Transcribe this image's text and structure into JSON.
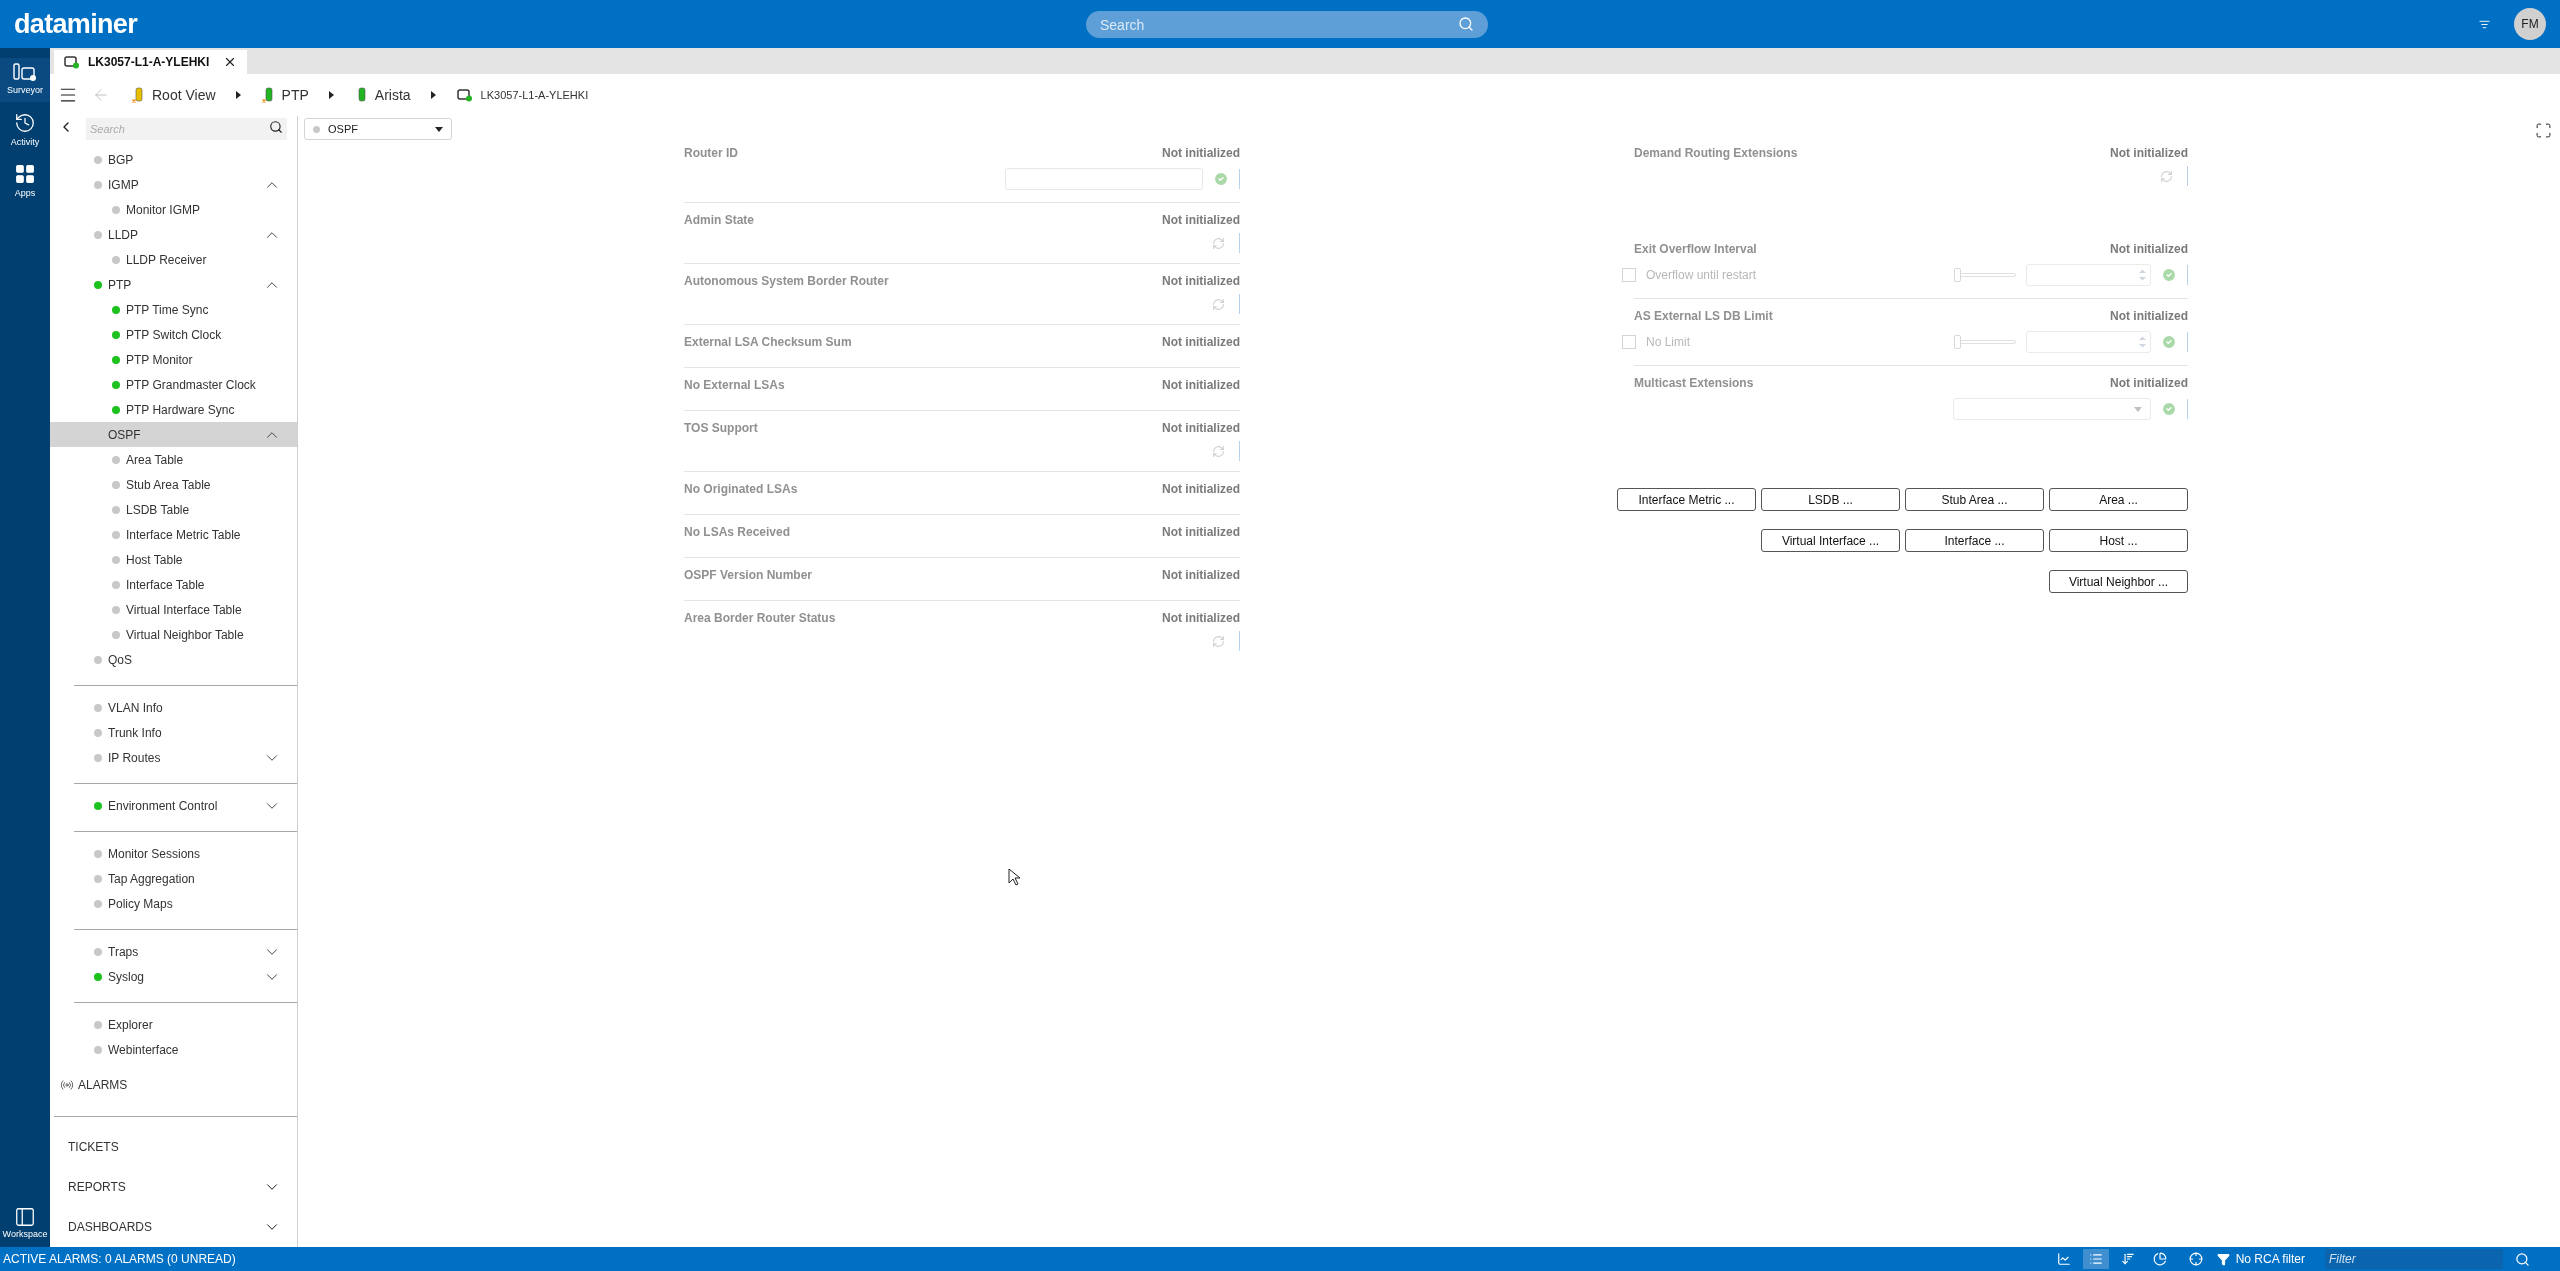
{
  "header": {
    "logo": "dataminer",
    "search": {
      "placeholder": "Search"
    },
    "avatar": "FM"
  },
  "rail": {
    "items": [
      {
        "kind": "surveyor",
        "label": "Surveyor",
        "selected": true
      },
      {
        "kind": "activity",
        "label": "Activity",
        "selected": false
      },
      {
        "kind": "apps",
        "label": "Apps",
        "selected": false
      }
    ],
    "workspace": "Workspace"
  },
  "tab": {
    "label": "LK3057-L1-A-YLEHKI"
  },
  "breadcrumb": [
    {
      "kind": "view-warning",
      "color": "#e8c000",
      "label": "Root View"
    },
    {
      "kind": "view-warning",
      "color": "#22b422",
      "label": "PTP"
    },
    {
      "kind": "view",
      "color": "#22b422",
      "label": "Arista"
    },
    {
      "kind": "element",
      "color": "#22b422",
      "label": "LK3057-L1-A-YLEHKI"
    }
  ],
  "sidebar": {
    "search": {
      "placeholder": "Search"
    },
    "sections": [
      [
        {
          "label": "BGP",
          "color": "#c8c8c8",
          "selected": false
        },
        {
          "label": "IGMP",
          "color": "#c8c8c8",
          "selected": false,
          "expanded": true,
          "children": [
            {
              "label": "Monitor IGMP",
              "color": "#c8c8c8",
              "selected": false
            }
          ]
        },
        {
          "label": "LLDP",
          "color": "#c8c8c8",
          "selected": false,
          "expanded": true,
          "children": [
            {
              "label": "LLDP Receiver",
              "color": "#c8c8c8",
              "selected": false
            }
          ]
        },
        {
          "label": "PTP",
          "color": "#1ec21e",
          "selected": false,
          "expanded": true,
          "children": [
            {
              "label": "PTP Time Sync",
              "color": "#1ec21e",
              "selected": false
            },
            {
              "label": "PTP Switch Clock",
              "color": "#1ec21e",
              "selected": false
            },
            {
              "label": "PTP Monitor",
              "color": "#1ec21e",
              "selected": false
            },
            {
              "label": "PTP Grandmaster Clock",
              "color": "#1ec21e",
              "selected": false
            },
            {
              "label": "PTP Hardware Sync",
              "color": "#1ec21e",
              "selected": false
            }
          ]
        },
        {
          "label": "OSPF",
          "selected": true,
          "expanded": true,
          "children": [
            {
              "label": "Area Table",
              "color": "#c8c8c8",
              "selected": false
            },
            {
              "label": "Stub Area Table",
              "color": "#c8c8c8",
              "selected": false
            },
            {
              "label": "LSDB Table",
              "color": "#c8c8c8",
              "selected": false
            },
            {
              "label": "Interface Metric Table",
              "color": "#c8c8c8",
              "selected": false
            },
            {
              "label": "Host Table",
              "color": "#c8c8c8",
              "selected": false
            },
            {
              "label": "Interface Table",
              "color": "#c8c8c8",
              "selected": false
            },
            {
              "label": "Virtual Interface Table",
              "color": "#c8c8c8",
              "selected": false
            },
            {
              "label": "Virtual Neighbor Table",
              "color": "#c8c8c8",
              "selected": false
            }
          ]
        },
        {
          "label": "QoS",
          "color": "#c8c8c8",
          "selected": false
        }
      ],
      [
        {
          "label": "VLAN Info",
          "color": "#c8c8c8",
          "selected": false
        },
        {
          "label": "Trunk Info",
          "color": "#c8c8c8",
          "selected": false
        },
        {
          "label": "IP Routes",
          "color": "#c8c8c8",
          "selected": false,
          "expanded": false
        }
      ],
      [
        {
          "label": "Environment Control",
          "color": "#1ec21e",
          "selected": false,
          "expanded": false
        }
      ],
      [
        {
          "label": "Monitor Sessions",
          "color": "#c8c8c8",
          "selected": false
        },
        {
          "label": "Tap Aggregation",
          "color": "#c8c8c8",
          "selected": false
        },
        {
          "label": "Policy Maps",
          "color": "#c8c8c8",
          "selected": false
        }
      ],
      [
        {
          "label": "Traps",
          "color": "#c8c8c8",
          "selected": false,
          "expanded": false
        },
        {
          "label": "Syslog",
          "color": "#1ec21e",
          "selected": false,
          "expanded": false
        }
      ],
      [
        {
          "label": "Explorer",
          "color": "#c8c8c8",
          "selected": false
        },
        {
          "label": "Webinterface",
          "color": "#c8c8c8",
          "selected": false
        }
      ]
    ],
    "alarms": "ALARMS",
    "modules": [
      {
        "label": "TICKETS"
      },
      {
        "label": "REPORTS",
        "expanded": false
      },
      {
        "label": "DASHBOARDS",
        "expanded": false
      }
    ]
  },
  "page_select": {
    "value": "OSPF"
  },
  "left_params": [
    {
      "label": "Router ID",
      "value": "Not initialized",
      "kind": "text"
    },
    {
      "label": "Admin State",
      "value": "Not initialized",
      "kind": "refresh"
    },
    {
      "label": "Autonomous System Border Router",
      "value": "Not initialized",
      "kind": "refresh"
    },
    {
      "label": "External LSA Checksum Sum",
      "value": "Not initialized",
      "kind": "plain"
    },
    {
      "label": "No External LSAs",
      "value": "Not initialized",
      "kind": "plain"
    },
    {
      "label": "TOS Support",
      "value": "Not initialized",
      "kind": "refresh"
    },
    {
      "label": "No Originated LSAs",
      "value": "Not initialized",
      "kind": "plain"
    },
    {
      "label": "No LSAs Received",
      "value": "Not initialized",
      "kind": "plain"
    },
    {
      "label": "OSPF Version Number",
      "value": "Not initialized",
      "kind": "plain"
    },
    {
      "label": "Area Border Router Status",
      "value": "Not initialized",
      "kind": "refresh"
    }
  ],
  "right_params": [
    {
      "label": "Demand Routing Extensions",
      "value": "Not initialized",
      "kind": "refresh"
    },
    {
      "label": "Exit Overflow Interval",
      "value": "Not initialized",
      "kind": "numeric",
      "checkbox": {
        "label": "Overflow until restart",
        "checked": false
      },
      "level": 0
    },
    {
      "label": "AS External LS DB Limit",
      "value": "Not initialized",
      "kind": "numeric",
      "checkbox": {
        "label": "No Limit",
        "checked": false
      },
      "level": 0
    },
    {
      "label": "Multicast Extensions",
      "value": "Not initialized",
      "kind": "dropdown"
    }
  ],
  "table_buttons": [
    [
      "Interface Metric ...",
      "LSDB ...",
      "Stub Area ...",
      "Area ..."
    ],
    [
      "Virtual Interface ...",
      "Interface ...",
      "Host ..."
    ],
    [
      "Virtual Neighbor ..."
    ]
  ],
  "status_bar": {
    "alarms": "ACTIVE ALARMS: 0 ALARMS (0 UNREAD)",
    "views": [
      {
        "kind": "chart",
        "selected": false
      },
      {
        "kind": "list",
        "selected": true
      },
      {
        "kind": "sort",
        "selected": false
      },
      {
        "kind": "pie",
        "selected": false
      }
    ],
    "rca": "No RCA filter",
    "filter": {
      "placeholder": "Filter"
    }
  }
}
